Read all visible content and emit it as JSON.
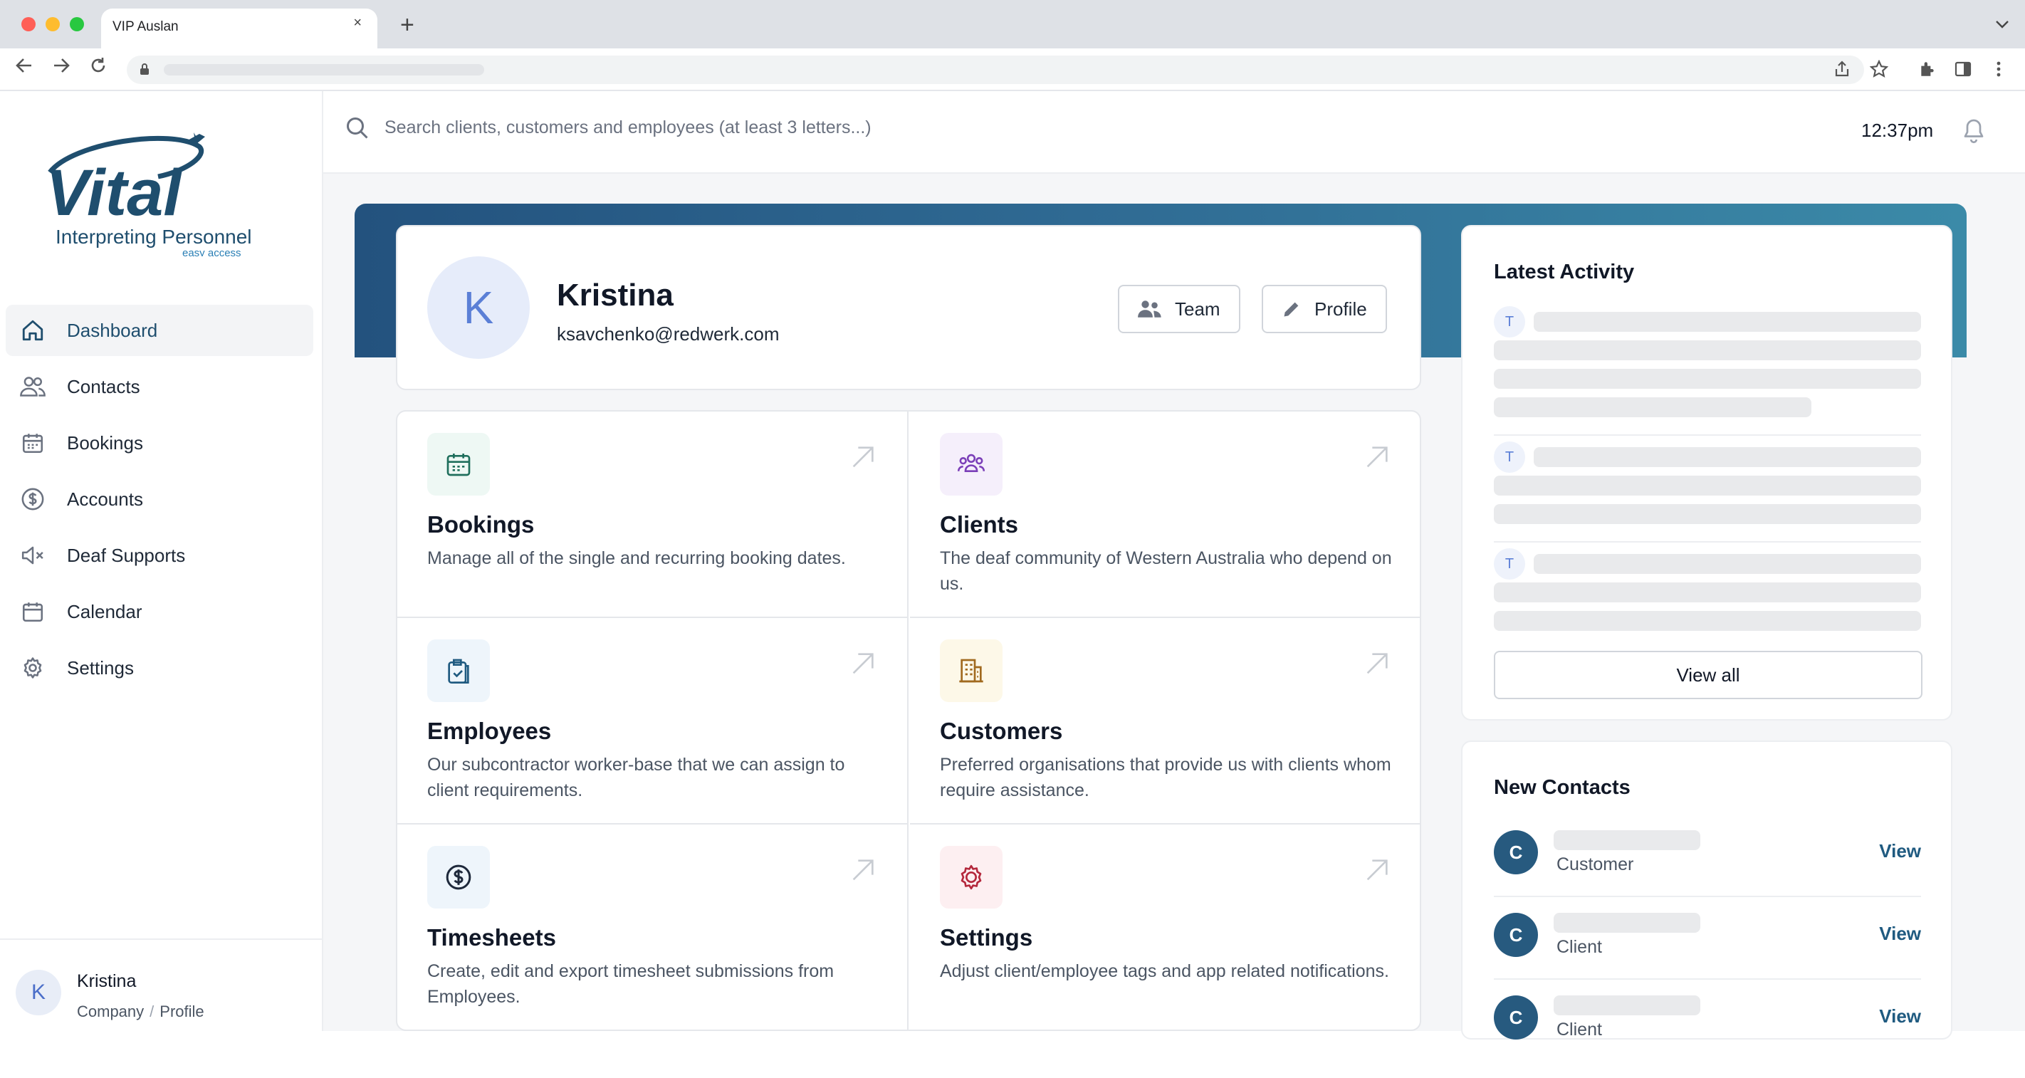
{
  "browser": {
    "tab_title": "VIP Auslan",
    "tab_close": "×",
    "new_tab": "+",
    "tabs_menu": "⌄"
  },
  "logo": {
    "brand": "Vital",
    "line2": "Interpreting Personnel",
    "line3": "easy access"
  },
  "sidebar": {
    "items": [
      {
        "label": "Dashboard",
        "icon": "home-icon",
        "active": true
      },
      {
        "label": "Contacts",
        "icon": "users-icon"
      },
      {
        "label": "Bookings",
        "icon": "calendar-icon"
      },
      {
        "label": "Accounts",
        "icon": "dollar-icon"
      },
      {
        "label": "Deaf Supports",
        "icon": "speaker-muted-icon"
      },
      {
        "label": "Calendar",
        "icon": "calendar-icon"
      },
      {
        "label": "Settings",
        "icon": "gear-icon"
      }
    ],
    "user": {
      "initial": "K",
      "name": "Kristina",
      "link_company": "Company",
      "separator": "/",
      "link_profile": "Profile"
    }
  },
  "header": {
    "search_placeholder": "Search clients, customers and employees (at least 3 letters...)",
    "time": "12:37pm"
  },
  "profile": {
    "initial": "K",
    "name": "Kristina",
    "email": "ksavchenko@redwerk.com",
    "team_button": "Team",
    "profile_button": "Profile"
  },
  "tiles": [
    {
      "title": "Bookings",
      "desc": "Manage all of the single and recurring booking dates.",
      "icon": "calendar-icon",
      "color": "#1f6f5c",
      "bg": "#eef8f4"
    },
    {
      "title": "Clients",
      "desc": "The deaf community of Western Australia who depend on us.",
      "icon": "community-icon",
      "color": "#7b3fb8",
      "bg": "#f5effb"
    },
    {
      "title": "Employees",
      "desc": "Our subcontractor worker-base that we can assign to client requirements.",
      "icon": "clipboard-check-icon",
      "color": "#1f5a80",
      "bg": "#eef5fb"
    },
    {
      "title": "Customers",
      "desc": "Preferred organisations that provide us with clients whom require assistance.",
      "icon": "building-icon",
      "color": "#a16a1f",
      "bg": "#fdf8e8"
    },
    {
      "title": "Timesheets",
      "desc": "Create, edit and export timesheet submissions from Employees.",
      "icon": "dollar-circle-icon",
      "color": "#1e293b",
      "bg": "#eef5fb"
    },
    {
      "title": "Settings",
      "desc": "Adjust client/employee tags and app related notifications.",
      "icon": "gear-icon",
      "color": "#b4283c",
      "bg": "#fdeff1"
    }
  ],
  "activity": {
    "title": "Latest Activity",
    "badges": [
      "T",
      "T",
      "T"
    ],
    "view_all": "View all"
  },
  "new_contacts": {
    "title": "New Contacts",
    "items": [
      {
        "initial": "C",
        "type": "Customer",
        "action": "View"
      },
      {
        "initial": "C",
        "type": "Client",
        "action": "View"
      },
      {
        "initial": "C",
        "type": "Client",
        "action": "View"
      }
    ]
  },
  "colors": {
    "accent": "#1f4e6e",
    "banner_start": "#23527e",
    "banner_end": "#3b8aa8",
    "link": "#1f5a80"
  }
}
